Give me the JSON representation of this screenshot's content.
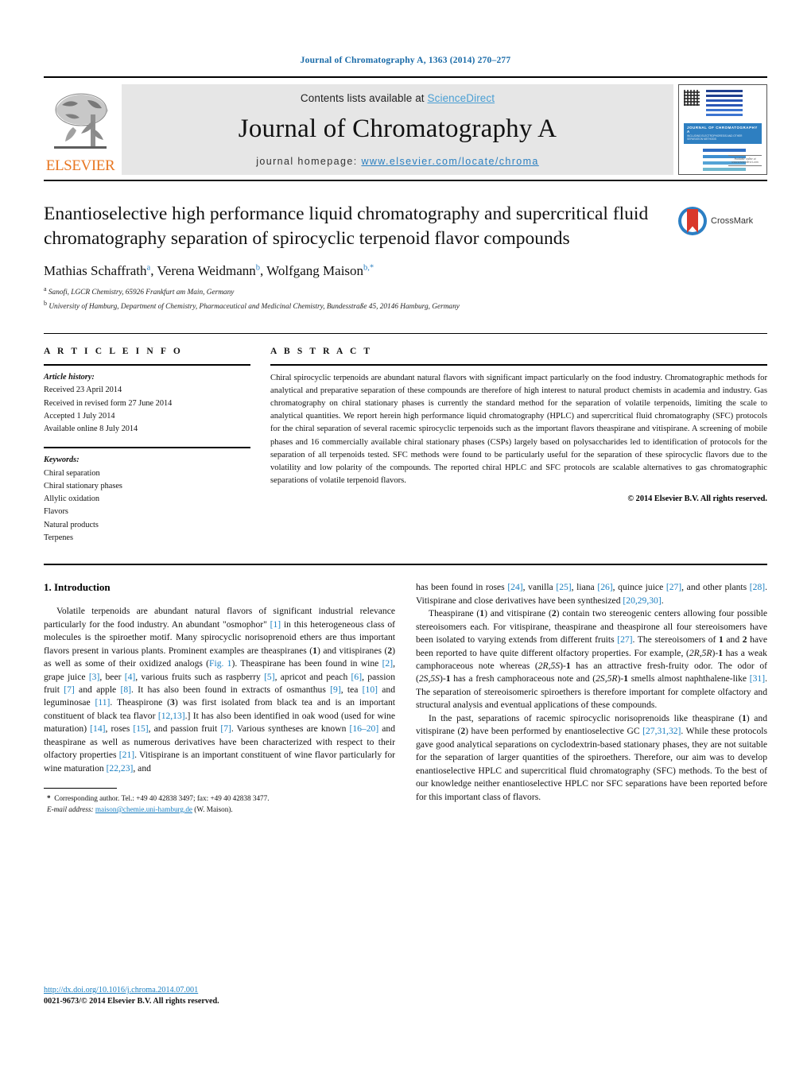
{
  "running_head": "Journal of Chromatography A, 1363 (2014) 270–277",
  "masthead": {
    "contents_prefix": "Contents lists available at ",
    "sciencedirect": "ScienceDirect",
    "journal_title": "Journal of Chromatography A",
    "homepage_prefix": "journal homepage: ",
    "homepage_url": "www.elsevier.com/locate/chroma",
    "publisher": "ELSEVIER",
    "cover": {
      "title_line": "JOURNAL OF CHROMATOGRAPHY A",
      "subtitle_line": "INCLUDING ELECTROPHORESIS AND OTHER SEPARATION METHODS",
      "foot_note": "Available online at www.sciencedirect.com",
      "bar_colors_top": [
        "#1f3f8f",
        "#1f3f8f",
        "#2a56b5",
        "#2a56b5",
        "#3c74d0",
        "#3c74d0"
      ],
      "bar_colors_stack": [
        "#2f6fc4",
        "#3f8fd0",
        "#54a3d6",
        "#6fb8cf",
        "#8cc4a8",
        "#a9cc7e",
        "#c6d45e",
        "#ddd248",
        "#edc63a",
        "#f2b234",
        "#f09a2e",
        "#ea7f2c",
        "#e2662c",
        "#d9502b",
        "#d2402d"
      ]
    }
  },
  "article": {
    "title": "Enantioselective high performance liquid chromatography and supercritical fluid chromatography separation of spirocyclic terpenoid flavor compounds",
    "crossmark_label": "CrossMark",
    "authors_html": "Mathias Schaffrath<sup>a</sup>, Verena Weidmann<sup>b</sup>, Wolfgang Maison<sup>b,*</sup>",
    "affiliations": [
      "Sanofi, LGCR Chemistry, 65926 Frankfurt am Main, Germany",
      "University of Hamburg, Department of Chemistry, Pharmaceutical and Medicinal Chemistry, Bundesstraße 45, 20146 Hamburg, Germany"
    ]
  },
  "article_info": {
    "heading": "A R T I C L E   I N F O",
    "history_label": "Article history:",
    "history": [
      "Received 23 April 2014",
      "Received in revised form 27 June 2014",
      "Accepted 1 July 2014",
      "Available online 8 July 2014"
    ],
    "keywords_label": "Keywords:",
    "keywords": [
      "Chiral separation",
      "Chiral stationary phases",
      "Allylic oxidation",
      "Flavors",
      "Natural products",
      "Terpenes"
    ]
  },
  "abstract": {
    "heading": "A B S T R A C T",
    "text": "Chiral spirocyclic terpenoids are abundant natural flavors with significant impact particularly on the food industry. Chromatographic methods for analytical and preparative separation of these compounds are therefore of high interest to natural product chemists in academia and industry. Gas chromatography on chiral stationary phases is currently the standard method for the separation of volatile terpenoids, limiting the scale to analytical quantities. We report herein high performance liquid chromatography (HPLC) and supercritical fluid chromatography (SFC) protocols for the chiral separation of several racemic spirocyclic terpenoids such as the important flavors theaspirane and vitispirane. A screening of mobile phases and 16 commercially available chiral stationary phases (CSPs) largely based on polysaccharides led to identification of protocols for the separation of all terpenoids tested. SFC methods were found to be particularly useful for the separation of these spirocyclic flavors due to the volatility and low polarity of the compounds. The reported chiral HPLC and SFC protocols are scalable alternatives to gas chromatographic separations of volatile terpenoid flavors.",
    "copyright": "© 2014 Elsevier B.V. All rights reserved."
  },
  "body": {
    "section_title": "1. Introduction",
    "left_paragraphs_html": [
      "Volatile terpenoids are abundant natural flavors of significant industrial relevance particularly for the food industry. An abundant \"osmophor\" <span class=\"ref\">[1]</span> in this heterogeneous class of molecules is the spiroether motif. Many spirocyclic norisoprenoid ethers are thus important flavors present in various plants. Prominent examples are theaspiranes (<span class=\"bld\">1</span>) and vitispiranes (<span class=\"bld\">2</span>) as well as some of their oxidized analogs (<span class=\"ref\">Fig. 1</span>). Theaspirane has been found in wine <span class=\"ref\">[2]</span>, grape juice <span class=\"ref\">[3]</span>, beer <span class=\"ref\">[4]</span>, various fruits such as raspberry <span class=\"ref\">[5]</span>, apricot and peach <span class=\"ref\">[6]</span>, passion fruit <span class=\"ref\">[7]</span> and apple <span class=\"ref\">[8]</span>. It has also been found in extracts of osmanthus <span class=\"ref\">[9]</span>, tea <span class=\"ref\">[10]</span> and leguminosae <span class=\"ref\">[11]</span>. Theaspirone (<span class=\"bld\">3</span>) was first isolated from black tea and is an important constituent of black tea flavor <span class=\"ref\">[12,13]</span>.] It has also been identified in oak wood (used for wine maturation) <span class=\"ref\">[14]</span>, roses <span class=\"ref\">[15]</span>, and passion fruit <span class=\"ref\">[7]</span>. Various syntheses are known <span class=\"ref\">[16–20]</span> and theaspirane as well as numerous derivatives have been characterized with respect to their olfactory properties <span class=\"ref\">[21]</span>. Vitispirane is an important constituent of wine flavor particularly for wine maturation <span class=\"ref\">[22,23]</span>, and"
    ],
    "right_paragraphs_html": [
      "has been found in roses <span class=\"ref\">[24]</span>, vanilla <span class=\"ref\">[25]</span>, liana <span class=\"ref\">[26]</span>, quince juice <span class=\"ref\">[27]</span>, and other plants <span class=\"ref\">[28]</span>. Vitispirane and close derivatives have been synthesized <span class=\"ref\">[20,29,30]</span>.",
      "Theaspirane (<span class=\"bld\">1</span>) and vitispirane (<span class=\"bld\">2</span>) contain two stereogenic centers allowing four possible stereoisomers each. For vitispirane, theaspirane and theaspirone all four stereoisomers have been isolated to varying extends from different fruits <span class=\"ref\">[27]</span>. The stereoisomers of <span class=\"bld\">1</span> and <span class=\"bld\">2</span> have been reported to have quite different olfactory properties. For example, (<span class=\"ital\">2R,5R</span>)-<span class=\"bld\">1</span> has a weak camphoraceous note whereas (<span class=\"ital\">2R,5S</span>)-<span class=\"bld\">1</span> has an attractive fresh-fruity odor. The odor of (<span class=\"ital\">2S,5S</span>)-<span class=\"bld\">1</span> has a fresh camphoraceous note and (<span class=\"ital\">2S,5R</span>)-<span class=\"bld\">1</span> smells almost naphthalene-like <span class=\"ref\">[31]</span>. The separation of stereoisomeric spiroethers is therefore important for complete olfactory and structural analysis and eventual applications of these compounds.",
      "In the past, separations of racemic spirocyclic norisoprenoids like theaspirane (<span class=\"bld\">1</span>) and vitispirane (<span class=\"bld\">2</span>) have been performed by enantioselective GC <span class=\"ref\">[27,31,32]</span>. While these protocols gave good analytical separations on cyclodextrin-based stationary phases, they are not suitable for the separation of larger quantities of the spiroethers. Therefore, our aim was to develop enantioselective HPLC and supercritical fluid chromatography (SFC) methods. To the best of our knowledge neither enantioselective HPLC nor SFC separations have been reported before for this important class of flavors."
    ]
  },
  "footnote": {
    "corresponding_html": "<span class=\"bld\">*</span>&nbsp; Corresponding author. Tel.: +49 40 42838 3497; fax: +49 40 42838 3477.",
    "email_label": "E-mail address:",
    "email": "maison@chemie.uni-hamburg.de",
    "email_suffix": "(W. Maison)."
  },
  "footer": {
    "doi": "http://dx.doi.org/10.1016/j.chroma.2014.07.001",
    "issn": "0021-9673/© 2014 Elsevier B.V. All rights reserved."
  }
}
